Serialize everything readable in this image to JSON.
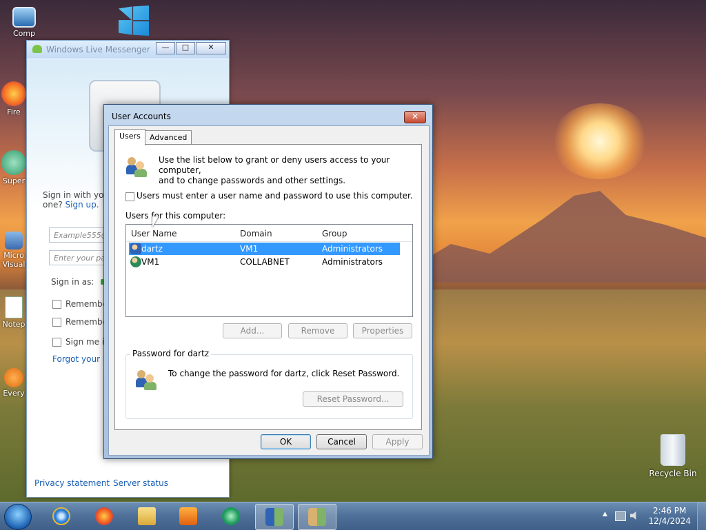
{
  "desktop": {
    "icons": [
      {
        "label": "Comp"
      },
      {
        "label": "Fire"
      },
      {
        "label": "Super"
      },
      {
        "label": "Micro Visual"
      },
      {
        "label": "Notep"
      },
      {
        "label": "Every"
      }
    ],
    "recycle_bin_label": "Recycle Bin"
  },
  "messenger": {
    "title": "Windows Live Messenger",
    "sign_in_prompt": "Sign in with your",
    "sign_in_prompt2": "one?",
    "sign_up_link": "Sign up.",
    "email_placeholder": "Example555@",
    "password_placeholder": "Enter your pass",
    "sign_in_as": "Sign in as:",
    "remember1": "Remember",
    "remember2": "Remember",
    "sign_me_in": "Sign me in",
    "forgot_link": "Forgot your p",
    "privacy_link": "Privacy statement",
    "server_status_link": "Server status",
    "title_buttons": {
      "minimize": "—",
      "maximize": "□",
      "close": "✕"
    }
  },
  "user_accounts": {
    "title": "User Accounts",
    "close_glyph": "✕",
    "tabs": [
      {
        "label": "Users"
      },
      {
        "label": "Advanced"
      }
    ],
    "intro_line1": "Use the list below to grant or deny users access to your computer,",
    "intro_line2": "and to change passwords and other settings.",
    "must_enter_checkbox": "Users must enter a user name and password to use this computer.",
    "users_for_label": "Users for this computer:",
    "columns": [
      "User Name",
      "Domain",
      "Group"
    ],
    "rows": [
      {
        "user": "dartz",
        "domain": "VM1",
        "group": "Administrators",
        "selected": true
      },
      {
        "user": "VM1",
        "domain": "COLLABNET",
        "group": "Administrators",
        "selected": false
      }
    ],
    "buttons": {
      "add": "Add...",
      "remove": "Remove",
      "properties": "Properties"
    },
    "password_group_title": "Password for dartz",
    "password_text": "To change the password for dartz, click Reset Password.",
    "reset_password": "Reset Password...",
    "ok": "OK",
    "cancel": "Cancel",
    "apply": "Apply"
  },
  "taskbar": {
    "time": "2:46 PM",
    "date": "12/4/2024",
    "tray_arrow": "▲",
    "apps": [
      {
        "icon": "internet-explorer-icon"
      },
      {
        "icon": "firefox-icon"
      },
      {
        "icon": "file-explorer-icon"
      },
      {
        "icon": "media-player-icon"
      },
      {
        "icon": "windows-live-messenger-icon"
      },
      {
        "icon": "users-icon"
      },
      {
        "icon": "user-accounts-icon"
      }
    ]
  }
}
